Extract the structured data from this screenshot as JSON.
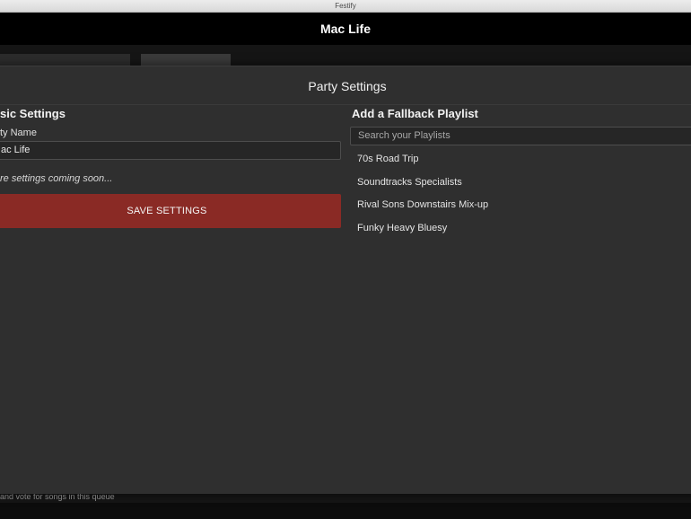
{
  "window": {
    "title": "Festify"
  },
  "header": {
    "title": "Mac Life"
  },
  "background": {
    "footer_text": "and vote for songs in this queue"
  },
  "modal": {
    "title": "Party Settings",
    "left": {
      "heading": "sic Settings",
      "party_name_label": "ty Name",
      "party_name_value": "ac Life",
      "coming_soon": "re settings coming soon...",
      "save_label": "SAVE SETTINGS"
    },
    "right": {
      "heading": "Add a Fallback Playlist",
      "search_placeholder": "Search your Playlists",
      "playlists": [
        "70s Road Trip",
        "Soundtracks Specialists",
        "Rival Sons Downstairs Mix-up",
        "Funky Heavy Bluesy"
      ]
    }
  },
  "colors": {
    "accent": "#8a2a25",
    "modal_bg": "#2f2f2f",
    "header_bg": "#000000"
  }
}
